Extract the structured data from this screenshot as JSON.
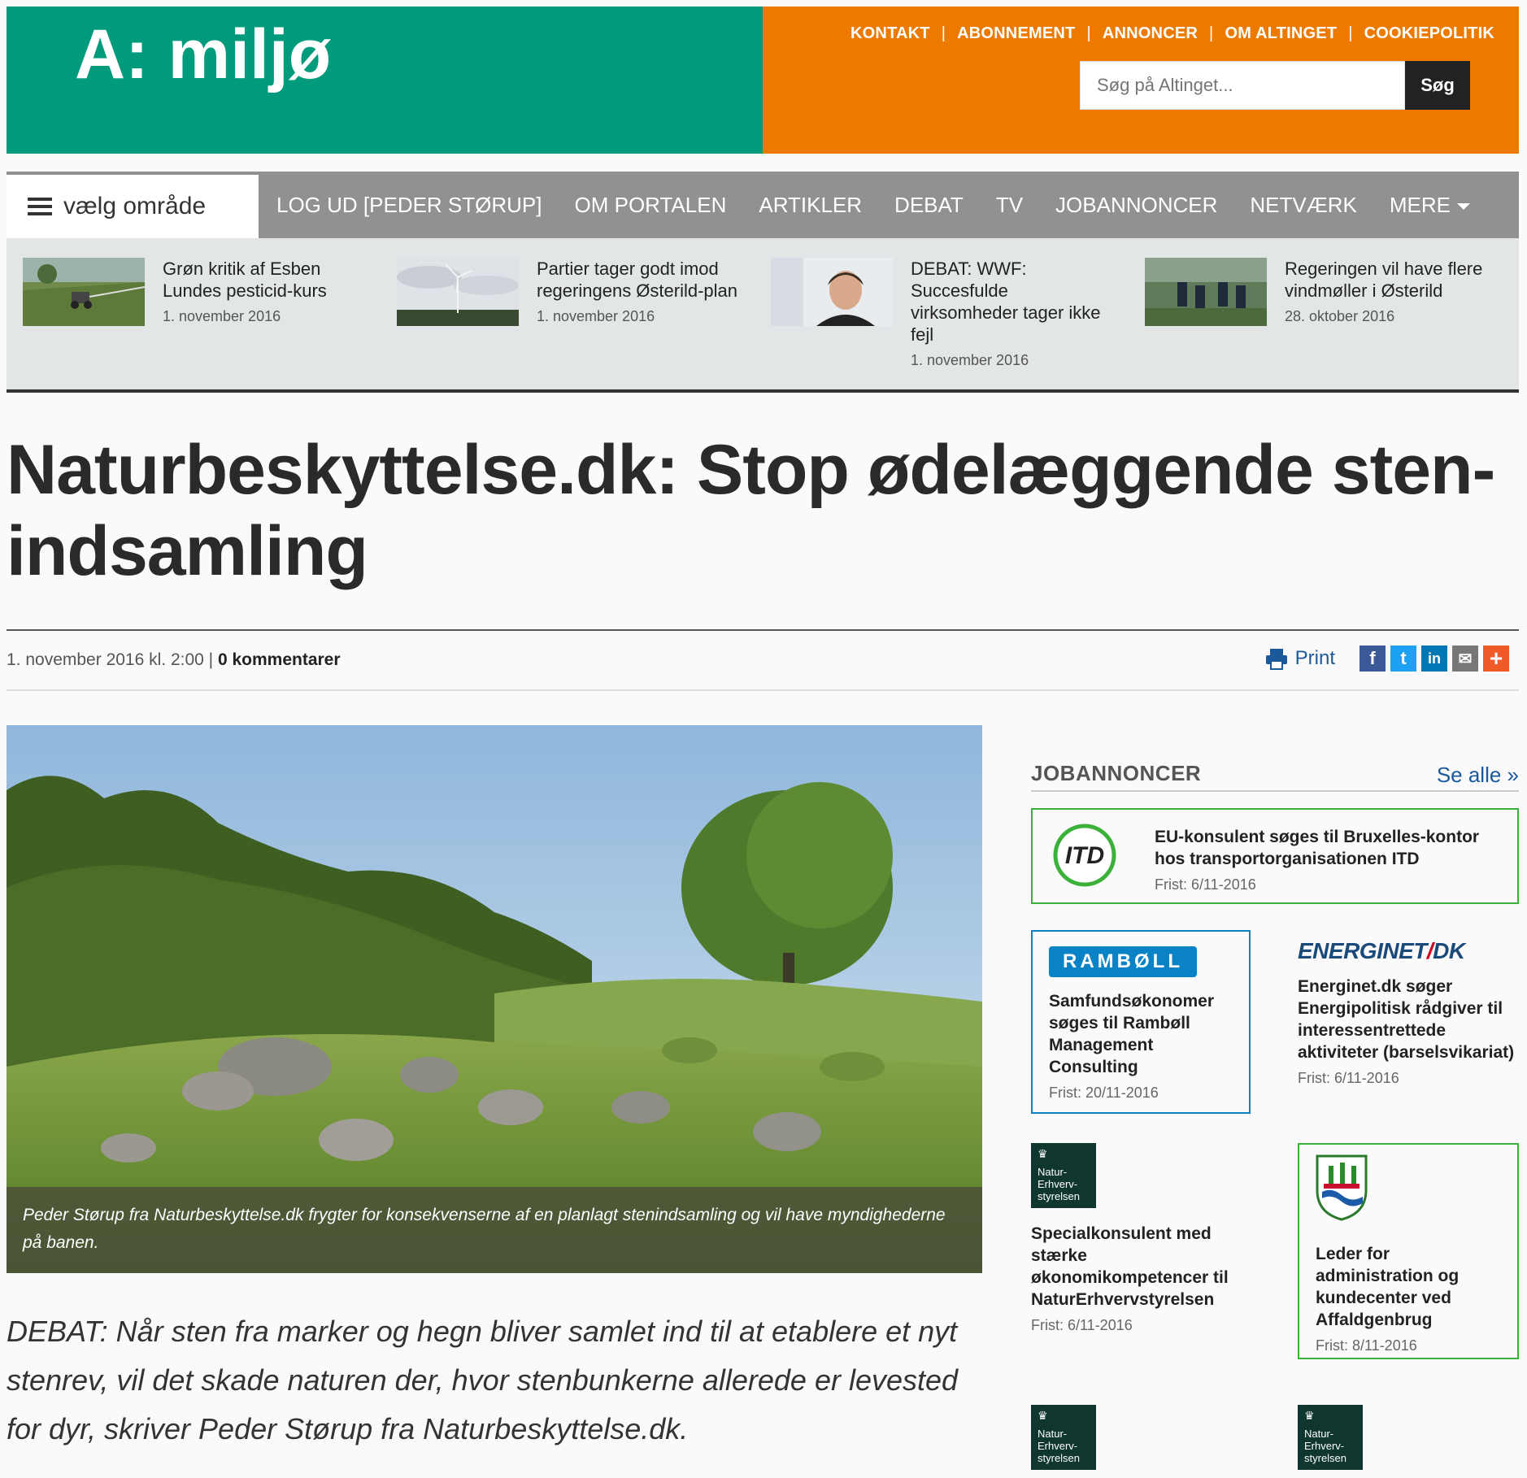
{
  "brand": {
    "logo_text": "A: miljø"
  },
  "toplinks": [
    "KONTAKT",
    "ABONNEMENT",
    "ANNONCER",
    "OM ALTINGET",
    "COOKIEPOLITIK"
  ],
  "search": {
    "placeholder": "Søg på Altinget...",
    "button": "Søg"
  },
  "nav": {
    "area_label": "vælg område",
    "items": [
      "LOG UD [PEDER STØRUP]",
      "OM PORTALEN",
      "ARTIKLER",
      "DEBAT",
      "TV",
      "JOBANNONCER",
      "NETVÆRK",
      "MERE"
    ]
  },
  "teasers": [
    {
      "title": "Grøn kritik af Esben Lundes pesticid-kurs",
      "date": "1. november 2016"
    },
    {
      "title": "Partier tager godt imod regeringens Østerild-plan",
      "date": "1. november 2016"
    },
    {
      "title": "DEBAT: WWF: Succesfulde virksomheder tager ikke fejl",
      "date": "1. november 2016"
    },
    {
      "title": "Regeringen vil have flere vindmøller i Østerild",
      "date": "28. oktober 2016"
    }
  ],
  "article": {
    "headline": "Naturbeskyttelse.dk: Stop ødelæggende sten-indsamling",
    "date": "1. november 2016 kl. 2:00",
    "comments": "0 kommentarer",
    "print": "Print",
    "caption": "Peder Størup fra Naturbeskyttelse.dk frygter for konsekvenserne af en planlagt stenindsamling og vil have myndighederne på banen.",
    "lead": "DEBAT: Når sten fra marker og hegn bliver samlet ind til at etablere et nyt stenrev, vil det skade naturen der, hvor stenbunkerne allerede er levested for dyr, skriver Peder Størup fra Naturbeskyttelse.dk."
  },
  "share_icons": [
    {
      "name": "facebook-icon",
      "glyph": "f",
      "color": "#3b5998"
    },
    {
      "name": "twitter-icon",
      "glyph": "t",
      "color": "#1da1f2"
    },
    {
      "name": "linkedin-icon",
      "glyph": "in",
      "color": "#0077b5"
    },
    {
      "name": "email-icon",
      "glyph": "✉",
      "color": "#777777"
    },
    {
      "name": "more-share-icon",
      "glyph": "+",
      "color": "#f05a28"
    }
  ],
  "jobs": {
    "title": "JOBANNONCER",
    "see_all": "Se alle »",
    "itd": {
      "logo": "ITD",
      "title": "EU-konsulent søges til Bruxelles-kontor hos transportorganisationen ITD",
      "deadline": "Frist: 6/11-2016"
    },
    "ramboll": {
      "logo": "RAMBØLL",
      "title": "Samfundsøkonomer søges til Rambøll Management Consulting",
      "deadline": "Frist: 20/11-2016"
    },
    "energinet": {
      "logo_a": "ENERGINET",
      "logo_slash": "/",
      "logo_b": "DK",
      "title": "Energinet.dk søger Energipolitisk rådgiver til interessentrettede aktiviteter (barselsvikariat)",
      "deadline": "Frist: 6/11-2016"
    },
    "nerv": {
      "logo": "Natur-Erhverv-styrelsen",
      "title": "Specialkonsulent med stærke økonomikompetencer til NaturErhvervstyrelsen",
      "deadline": "Frist: 6/11-2016"
    },
    "affald": {
      "title": "Leder for administration og kundecenter ved Affaldgenbrug",
      "deadline": "Frist: 8/11-2016"
    },
    "nerv2": {
      "logo": "Natur-Erhverv-styrelsen"
    },
    "nerv3": {
      "logo": "Natur-Erhverv-styrelsen"
    }
  },
  "colors": {
    "brand_green": "#009b7d",
    "brand_orange": "#ec7a00",
    "nav_gray": "#919191",
    "link_blue": "#1a5a9a"
  }
}
